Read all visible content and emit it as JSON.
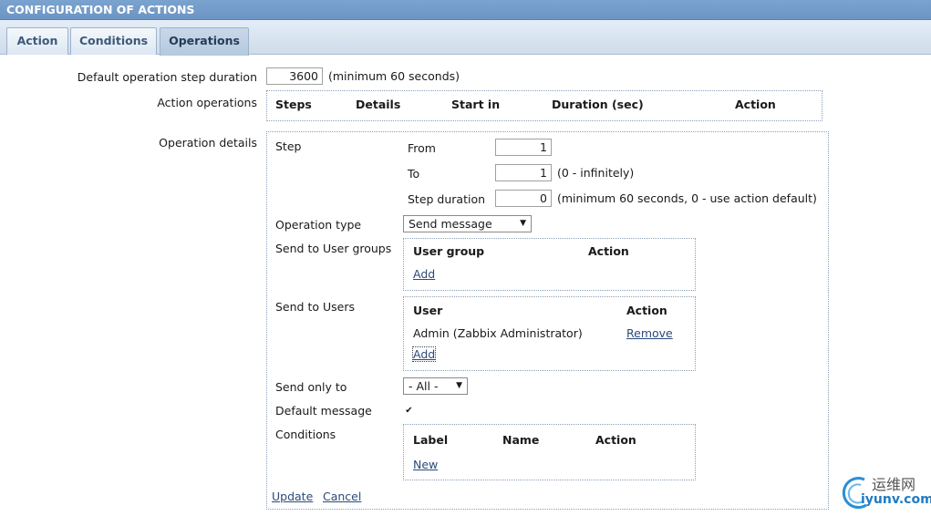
{
  "window": {
    "title": "CONFIGURATION OF ACTIONS"
  },
  "tabs": [
    {
      "label": "Action"
    },
    {
      "label": "Conditions"
    },
    {
      "label": "Operations"
    }
  ],
  "form": {
    "default_step_duration": {
      "label": "Default operation step duration",
      "value": "3600",
      "hint": "(minimum 60 seconds)"
    },
    "action_operations": {
      "label": "Action operations",
      "columns": [
        "Steps",
        "Details",
        "Start in",
        "Duration (sec)",
        "Action"
      ]
    },
    "operation_details": {
      "label": "Operation details",
      "step_label": "Step",
      "from": {
        "label": "From",
        "value": "1"
      },
      "to": {
        "label": "To",
        "value": "1",
        "hint": "(0 - infinitely)"
      },
      "step_duration": {
        "label": "Step duration",
        "value": "0",
        "hint": "(minimum 60 seconds, 0 - use action default)"
      },
      "operation_type": {
        "label": "Operation type",
        "selected": "Send message"
      },
      "user_groups": {
        "label": "Send to User groups",
        "columns": [
          "User group",
          "Action"
        ],
        "add": "Add"
      },
      "users": {
        "label": "Send to Users",
        "columns": [
          "User",
          "Action"
        ],
        "rows": [
          {
            "user": "Admin (Zabbix Administrator)",
            "action": "Remove"
          }
        ],
        "add": "Add"
      },
      "send_only_to": {
        "label": "Send only to",
        "selected": "- All -"
      },
      "default_message": {
        "label": "Default message",
        "checked": true
      },
      "conditions": {
        "label": "Conditions",
        "columns": [
          "Label",
          "Name",
          "Action"
        ],
        "new": "New"
      },
      "update": "Update",
      "cancel": "Cancel"
    }
  },
  "watermark": {
    "top": "运维网",
    "bottom": "iyunv.com"
  },
  "colors": {
    "titlebar": "#6b95c4",
    "link": "#2b4a7b",
    "tab_active": "#b5c9de"
  }
}
